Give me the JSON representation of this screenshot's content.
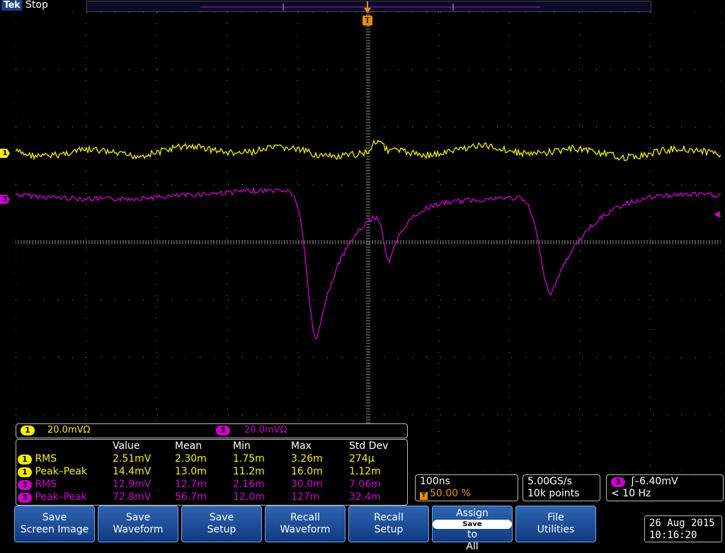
{
  "header": {
    "brand": "Tek",
    "state": "Stop",
    "trigger_marker": "T"
  },
  "channels": {
    "ch1_label": "1",
    "ch3_label": "3"
  },
  "scale": {
    "ch1": "20.0mVΩ",
    "ch3": "20.0mVΩ"
  },
  "measurements": {
    "columns": [
      "",
      "Value",
      "Mean",
      "Min",
      "Max",
      "Std Dev"
    ],
    "rows": [
      {
        "channel": "1",
        "name": "RMS",
        "value": "2.51mV",
        "mean": "2.30m",
        "min": "1.75m",
        "max": "3.26m",
        "std": "274µ",
        "color": "#f4f000"
      },
      {
        "channel": "1",
        "name": "Peak–Peak",
        "value": "14.4mV",
        "mean": "13.0m",
        "min": "11.2m",
        "max": "16.0m",
        "std": "1.12m",
        "color": "#f4f000"
      },
      {
        "channel": "3",
        "name": "RMS",
        "value": "12.9mV",
        "mean": "12.7m",
        "min": "2.16m",
        "max": "30.0m",
        "std": "7.06m",
        "color": "#d000d0"
      },
      {
        "channel": "3",
        "name": "Peak–Peak",
        "value": "72.8mV",
        "mean": "56.7m",
        "min": "12.0m",
        "max": "127m",
        "std": "32.4m",
        "color": "#d000d0"
      }
    ]
  },
  "horizontal": {
    "timebase": "100ns",
    "trigger_position": "50.00 %"
  },
  "sampling": {
    "rate": "5.00GS/s",
    "record": "10k points"
  },
  "trigger": {
    "channel": "3",
    "level": "–6.40mV",
    "freq": "< 10 Hz"
  },
  "buttons": {
    "save_screen": [
      "Save",
      "Screen Image"
    ],
    "save_waveform": [
      "Save",
      "Waveform"
    ],
    "save_setup": [
      "Save",
      "Setup"
    ],
    "recall_waveform": [
      "Recall",
      "Waveform"
    ],
    "recall_setup": [
      "Recall",
      "Setup"
    ],
    "assign": [
      "Assign",
      "Save",
      "to",
      "All"
    ],
    "file": [
      "File",
      "Utilities"
    ]
  },
  "datetime": {
    "date": "26 Aug 2015",
    "time": "10:16:20"
  },
  "colors": {
    "ch1": "#f4f000",
    "ch3": "#d000d0",
    "trigger": "#f28c00",
    "grid": "#8a8a8a"
  }
}
